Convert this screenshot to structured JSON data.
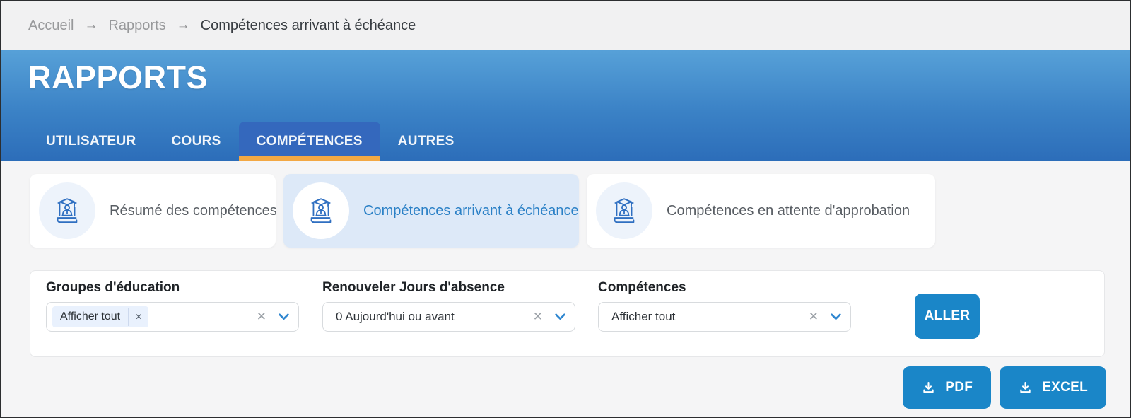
{
  "breadcrumb": {
    "items": [
      {
        "label": "Accueil"
      },
      {
        "label": "Rapports"
      },
      {
        "label": "Compétences arrivant à échéance"
      }
    ]
  },
  "icons": {
    "breadcrumb_separator": "→",
    "clear": "✕",
    "tag_remove": "✕"
  },
  "header": {
    "title": "RAPPORTS",
    "tabs": [
      {
        "label": "UTILISATEUR",
        "active": false
      },
      {
        "label": "COURS",
        "active": false
      },
      {
        "label": "COMPÉTENCES",
        "active": true
      },
      {
        "label": "AUTRES",
        "active": false
      }
    ]
  },
  "report_cards": [
    {
      "label": "Résumé des compétences",
      "selected": false
    },
    {
      "label": "Compétences arrivant à échéance",
      "selected": true
    },
    {
      "label": "Compétences en attente d'approbation",
      "selected": false
    }
  ],
  "filters": {
    "groups": [
      {
        "label": "Groupes d'éducation",
        "value": "Afficher tout",
        "style": "tag"
      },
      {
        "label": "Renouveler Jours d'absence",
        "value": "0 Aujourd'hui ou avant",
        "style": "text"
      },
      {
        "label": "Compétences",
        "value": "Afficher tout",
        "style": "text"
      }
    ],
    "go_label": "ALLER"
  },
  "export": {
    "pdf_label": "PDF",
    "excel_label": "EXCEL"
  },
  "colors": {
    "header_gradient_top": "#57a1d8",
    "header_gradient_bottom": "#2c6db9",
    "active_tab_bg": "#3468bd",
    "active_tab_underline": "#f3a844",
    "accent_blue": "#1a86c8",
    "selected_card_bg": "#dde9f8",
    "selected_card_text": "#2a80c6"
  }
}
